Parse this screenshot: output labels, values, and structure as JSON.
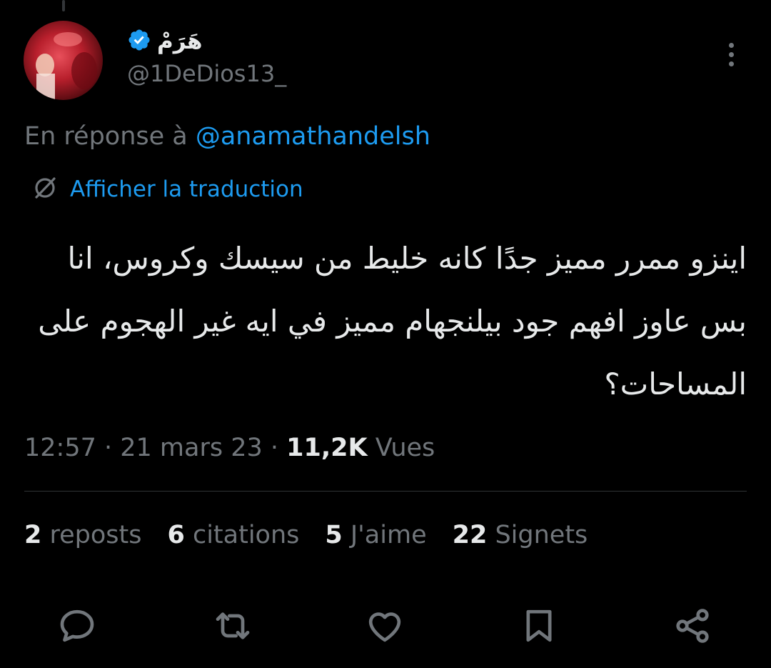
{
  "author": {
    "display_name": "هَرَمْ",
    "handle": "@1DeDios13_",
    "verified": true
  },
  "reply": {
    "prefix": "En réponse à ",
    "handle": "@anamathandelsh"
  },
  "translate": {
    "label": "Afficher la traduction"
  },
  "tweet": {
    "text": "اينزو ممرر مميز جدًا كانه خليط من سيسك وكروس، انا بس عاوز افهم جود بيلنجهام مميز في ايه غير الهجوم على المساحات؟"
  },
  "meta": {
    "time": "12:57",
    "separator": " · ",
    "date": "21 mars 23",
    "views_count": "11,2K",
    "views_label": " Vues"
  },
  "stats": [
    {
      "count": "2",
      "label": " reposts"
    },
    {
      "count": "6",
      "label": " citations"
    },
    {
      "count": "5",
      "label": " J'aime"
    },
    {
      "count": "22",
      "label": " Signets"
    }
  ],
  "actions": [
    "reply-icon",
    "repost-icon",
    "like-icon",
    "bookmark-icon",
    "share-icon"
  ],
  "colors": {
    "background": "#000000",
    "primary_text": "#e7e9ea",
    "secondary_text": "#71767b",
    "accent": "#1d9bf0",
    "divider": "#2f3336"
  }
}
